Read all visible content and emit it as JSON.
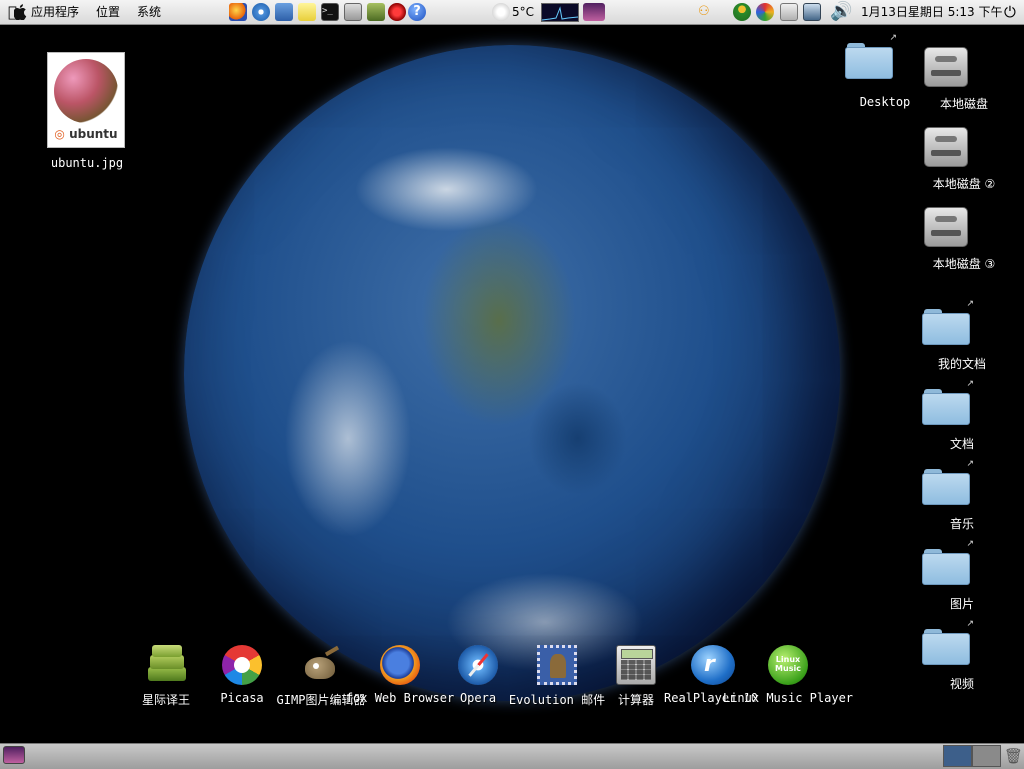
{
  "top_panel": {
    "menu_applications": "应用程序",
    "menu_places": "位置",
    "menu_system": "系统",
    "launchers": [
      "firefox-icon",
      "safari-icon",
      "text-editor-icon",
      "notes-icon",
      "terminal-icon",
      "calculator-icon",
      "dictionary-icon",
      "record-icon",
      "help-icon"
    ],
    "weather": "5°C",
    "clock": "1月13日星期日  5:13 下午",
    "colors": {
      "panel": "#e4e4e4"
    }
  },
  "desktop": {
    "left_icons": [
      {
        "label": "ubuntu.jpg",
        "thumb_word": "ubuntu"
      }
    ],
    "right_icons": [
      {
        "label": "Desktop",
        "type": "folder"
      },
      {
        "label": "本地磁盘",
        "type": "hdd"
      },
      {
        "label": "本地磁盘 ②",
        "type": "hdd"
      },
      {
        "label": "本地磁盘 ③",
        "type": "hdd"
      },
      {
        "label": "我的文档",
        "type": "folder"
      },
      {
        "label": "文档",
        "type": "folder"
      },
      {
        "label": "音乐",
        "type": "folder"
      },
      {
        "label": "图片",
        "type": "folder"
      },
      {
        "label": "视频",
        "type": "folder"
      }
    ]
  },
  "dock": {
    "items": [
      {
        "label": "星际译王",
        "icon": "stardict-icon"
      },
      {
        "label": "Picasa",
        "icon": "picasa-icon"
      },
      {
        "label": "GIMP图片编辑器",
        "icon": "gimp-icon"
      },
      {
        "label": "fox Web Browser",
        "icon": "firefox-icon"
      },
      {
        "label": "Opera",
        "icon": "opera-icon"
      },
      {
        "label": "Evolution 邮件",
        "icon": "evolution-icon"
      },
      {
        "label": "计算器",
        "icon": "calculator-icon"
      },
      {
        "label": "RealPlayer 10",
        "icon": "realplayer-icon"
      },
      {
        "label": "Linux Music Player",
        "icon": "music-player-icon"
      }
    ]
  }
}
